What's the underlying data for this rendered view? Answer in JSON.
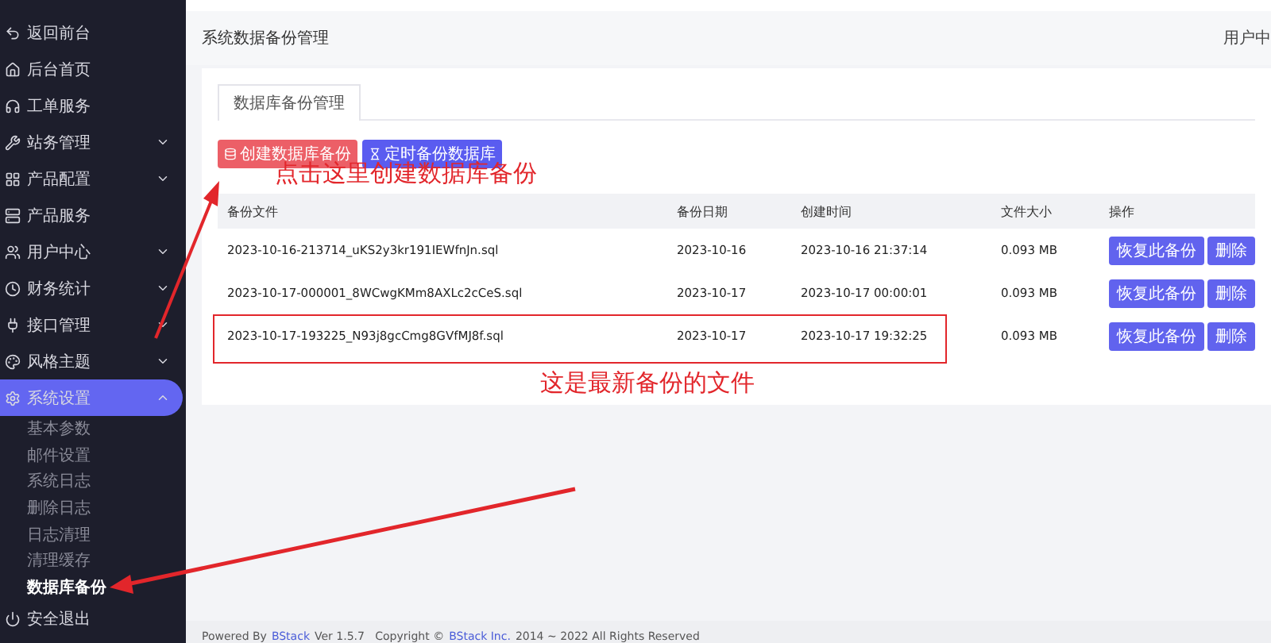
{
  "sidebar": {
    "items": [
      {
        "label": "返回前台",
        "selected": false
      },
      {
        "label": "后台首页",
        "selected": false
      },
      {
        "label": "工单服务",
        "selected": false
      },
      {
        "label": "站务管理",
        "selected": false,
        "expanded": false
      },
      {
        "label": "产品配置",
        "selected": false,
        "expanded": false
      },
      {
        "label": "产品服务",
        "selected": false
      },
      {
        "label": "用户中心",
        "selected": false,
        "expanded": false
      },
      {
        "label": "财务统计",
        "selected": false,
        "expanded": false
      },
      {
        "label": "接口管理",
        "selected": false,
        "expanded": false
      },
      {
        "label": "风格主题",
        "selected": false,
        "expanded": false
      },
      {
        "label": "系统设置",
        "selected": true,
        "expanded": true,
        "children": [
          {
            "label": "基本参数",
            "selected": false
          },
          {
            "label": "邮件设置",
            "selected": false
          },
          {
            "label": "系统日志",
            "selected": false
          },
          {
            "label": "删除日志",
            "selected": false
          },
          {
            "label": "日志清理",
            "selected": false
          },
          {
            "label": "清理缓存",
            "selected": false
          },
          {
            "label": "数据库备份",
            "selected": true
          }
        ]
      },
      {
        "label": "安全退出",
        "selected": false
      }
    ]
  },
  "header": {
    "title": "系统数据备份管理",
    "user_menu": "用户中"
  },
  "tabs": [
    {
      "label": "数据库备份管理",
      "selected": true
    }
  ],
  "toolbar": [
    {
      "label": "创建数据库备份",
      "kind": "danger"
    },
    {
      "label": "定时备份数据库",
      "kind": "primary"
    }
  ],
  "table": {
    "columns": [
      "备份文件",
      "备份日期",
      "创建时间",
      "文件大小",
      "操作"
    ],
    "rows": [
      {
        "file": "2023-10-16-213714_uKS2y3kr191IEWfnJn.sql",
        "date": "2023-10-16",
        "created": "2023-10-16 21:37:14",
        "size": "0.093 MB",
        "actions": [
          "恢复此备份",
          "删除"
        ],
        "outlined": false
      },
      {
        "file": "2023-10-17-000001_8WCwgKMm8AXLc2cCeS.sql",
        "date": "2023-10-17",
        "created": "2023-10-17 00:00:01",
        "size": "0.093 MB",
        "actions": [
          "恢复此备份",
          "删除"
        ],
        "outlined": false
      },
      {
        "file": "2023-10-17-193225_N93j8gcCmg8GVfMJ8f.sql",
        "date": "2023-10-17",
        "created": "2023-10-17 19:32:25",
        "size": "0.093 MB",
        "actions": [
          "恢复此备份",
          "删除"
        ],
        "outlined": true
      }
    ]
  },
  "annotations": [
    "点击这里创建数据库备份",
    "这是最新备份的文件"
  ],
  "footer": [
    {
      "kind": "text",
      "text": "Powered By"
    },
    {
      "kind": "link",
      "text": "BStack"
    },
    {
      "kind": "text",
      "text": "Ver 1.5.7   Copyright ©"
    },
    {
      "kind": "link",
      "text": "BStack Inc."
    },
    {
      "kind": "text",
      "text": "2014 ~ 2022 All Rights Reserved"
    }
  ]
}
